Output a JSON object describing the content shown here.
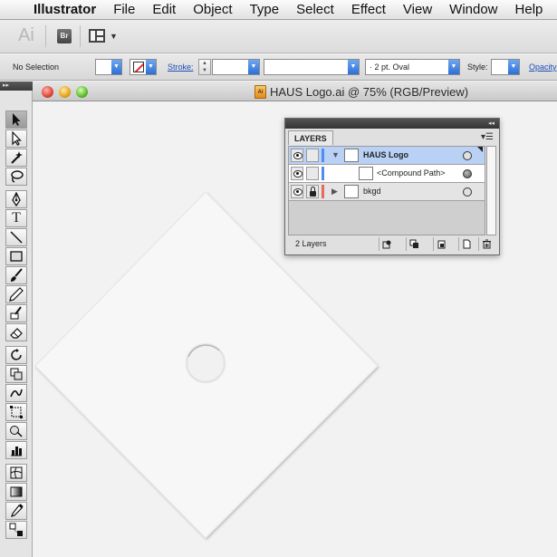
{
  "menubar": {
    "app_name": "Illustrator",
    "items": [
      "File",
      "Edit",
      "Object",
      "Type",
      "Select",
      "Effect",
      "View",
      "Window",
      "Help"
    ]
  },
  "appbar": {
    "logo_text": "Ai",
    "bridge_label": "Br"
  },
  "controlbar": {
    "selection_label": "No Selection",
    "stroke_label": "Stroke:",
    "brush_value": "·   2 pt. Oval",
    "style_label": "Style:",
    "opacity_label": "Opacity"
  },
  "document": {
    "file_icon_label": "Ai",
    "title": "HAUS Logo.ai @ 75% (RGB/Preview)"
  },
  "layers_panel": {
    "tab_label": "LAYERS",
    "rows": [
      {
        "name": "HAUS Logo",
        "color": "#4f8df2",
        "selected": true
      },
      {
        "name": "<Compound Path>",
        "color": "#4f8df2",
        "selected": false
      },
      {
        "name": "bkgd",
        "color": "#e76a5c",
        "selected": false
      }
    ],
    "layer_count": "2 Layers"
  },
  "colors": {
    "selection_highlight": "#b8d1f5",
    "accent_blue": "#2d6fd6",
    "canvas": "#f2f2f2"
  }
}
